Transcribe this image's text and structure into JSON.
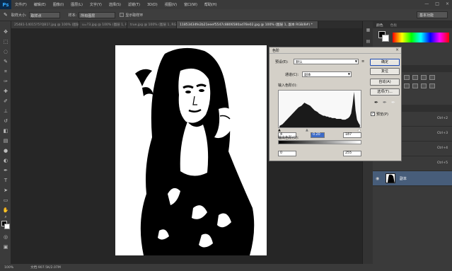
{
  "app": {
    "logo": "Ps"
  },
  "menu": [
    "文件(F)",
    "编辑(E)",
    "图像(I)",
    "图层(L)",
    "文字(Y)",
    "选择(S)",
    "滤镜(T)",
    "3D(D)",
    "视图(V)",
    "窗口(W)",
    "帮助(H)"
  ],
  "window_controls": [
    "—",
    "□",
    "×"
  ],
  "options": {
    "size_label": "取样大小:",
    "sample_value": "取样点",
    "layer_label": "样本:",
    "layer_value": "所有图层",
    "show_ring": "显示取样环",
    "workspace": "基本功能"
  },
  "tabs": [
    {
      "label": "25481-14015?5?QB1?.jpg @ 100% (图层 0, RGB/8#) *"
    },
    {
      "label": "u=?3.jpg @ 100% (图层 1, RGB/8#) *"
    },
    {
      "label": "true.jpg @ 100% (图层 1, RGB/8#) *"
    },
    {
      "label": "11853434fe2b21eeef5547c8806580ad78e02.jpg @ 100% (图层 1, 副本 RGB/8#) *",
      "active": true
    }
  ],
  "statusbar": {
    "zoom": "100%",
    "doc": "文档:907.5K/2.07M"
  },
  "panels": {
    "color_tabs": [
      "颜色",
      "色板"
    ],
    "layers": [
      {
        "shortcut": "Ctrl+2"
      },
      {
        "shortcut": "Ctrl+3"
      },
      {
        "shortcut": "Ctrl+4"
      },
      {
        "shortcut": "Ctrl+5"
      },
      {
        "name": "副本",
        "selected": true
      }
    ]
  },
  "levels": {
    "title": "色阶",
    "preset_label": "预设(E):",
    "preset_value": "默认",
    "channel_label": "通道(C):",
    "channel_value": "副本",
    "input_label": "输入色阶(I):",
    "input_values": [
      "4",
      "0.20",
      "187"
    ],
    "output_label": "输出色阶(O):",
    "output_values": [
      "0",
      "255"
    ],
    "buttons": {
      "ok": "确定",
      "reset": "复位",
      "auto": "自动(A)",
      "options": "选项(T)..."
    },
    "preview_label": "预览(P)",
    "preview_checked": "✓",
    "histogram_levels": [
      2,
      3,
      4,
      6,
      8,
      10,
      12,
      14,
      16,
      18,
      20,
      22,
      24,
      26,
      27,
      28,
      30,
      32,
      31,
      30,
      29,
      28,
      26,
      24,
      22,
      21,
      20,
      18,
      17,
      16,
      15,
      15,
      14,
      14,
      13,
      13,
      12,
      12,
      12,
      11,
      11,
      11,
      11,
      10,
      10,
      10,
      11,
      12,
      14,
      18,
      30,
      46,
      22,
      10,
      6,
      3
    ]
  }
}
